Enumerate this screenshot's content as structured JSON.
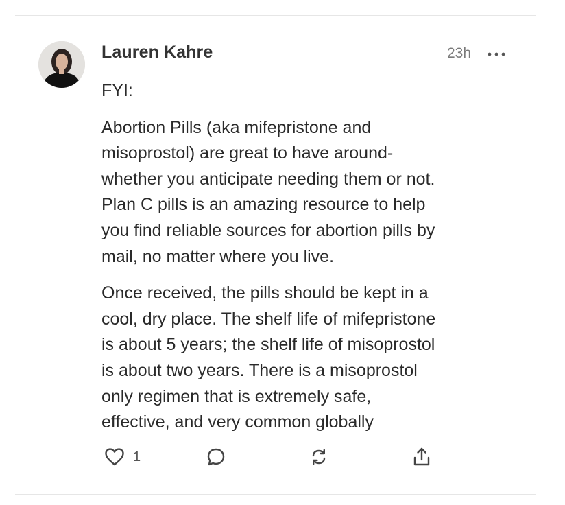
{
  "post": {
    "author": "Lauren Kahre",
    "time": "23h",
    "paragraphs": [
      "FYI:",
      "Abortion Pills (aka mifepristone and\nmisoprostol) are great to have around-\nwhether you anticipate needing them or not.\nPlan C pills is an amazing resource to help\nyou find reliable sources for abortion pills by\nmail, no matter where you live.",
      "Once received, the pills should be kept in a\ncool, dry place. The shelf life of mifepristone\nis about 5 years; the shelf life of misoprostol\nis about two years. There is a misoprostol\nonly regimen that is extremely safe,\neffective, and very common globally"
    ],
    "actions": {
      "like_count": "1",
      "like_icon": "heart-icon",
      "reply_icon": "comment-icon",
      "repost_icon": "repost-icon",
      "share_icon": "share-icon"
    }
  },
  "colors": {
    "text": "#2a2a2a",
    "muted": "#7a7a7a",
    "divider": "#e6e6e6"
  }
}
